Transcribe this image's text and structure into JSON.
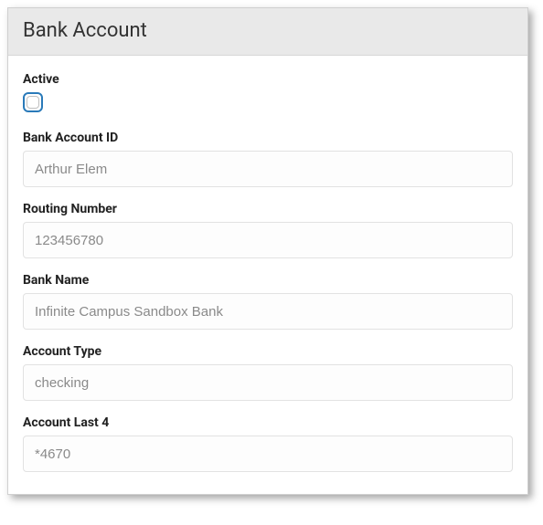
{
  "panel": {
    "title": "Bank Account"
  },
  "fields": {
    "active": {
      "label": "Active",
      "checked": false
    },
    "bank_account_id": {
      "label": "Bank Account ID",
      "value": "Arthur Elem"
    },
    "routing_number": {
      "label": "Routing Number",
      "value": "123456780"
    },
    "bank_name": {
      "label": "Bank Name",
      "value": "Infinite Campus Sandbox Bank"
    },
    "account_type": {
      "label": "Account Type",
      "value": "checking"
    },
    "account_last_4": {
      "label": "Account Last 4",
      "value": "*4670"
    }
  }
}
